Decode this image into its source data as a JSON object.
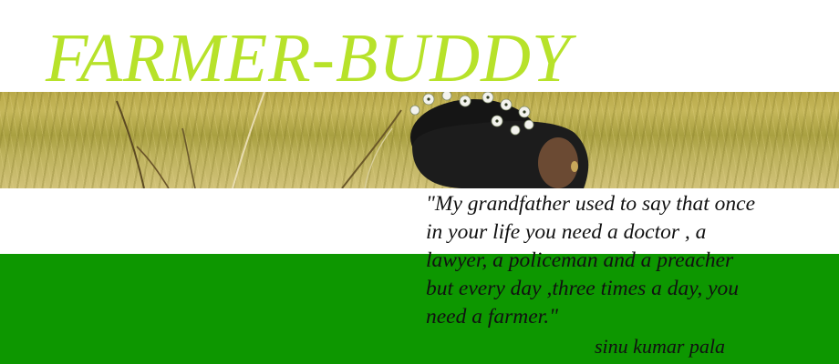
{
  "header": {
    "title": "FARMER-BUDDY",
    "title_color": "#b7e22a"
  },
  "banner": {
    "photo_description_icon": "woman-with-flowers-in-hair-in-field",
    "band_colors": {
      "top": "#ffffff",
      "middle": "#ffffff",
      "bottom": "#0d9700"
    }
  },
  "quote": {
    "text": "\"My grandfather used to say that once\nin your life you need a doctor , a\nlawyer, a policeman and a preacher\nbut every day ,three times a day, you\nneed a farmer.\"",
    "author": "sinu kumar pala"
  }
}
